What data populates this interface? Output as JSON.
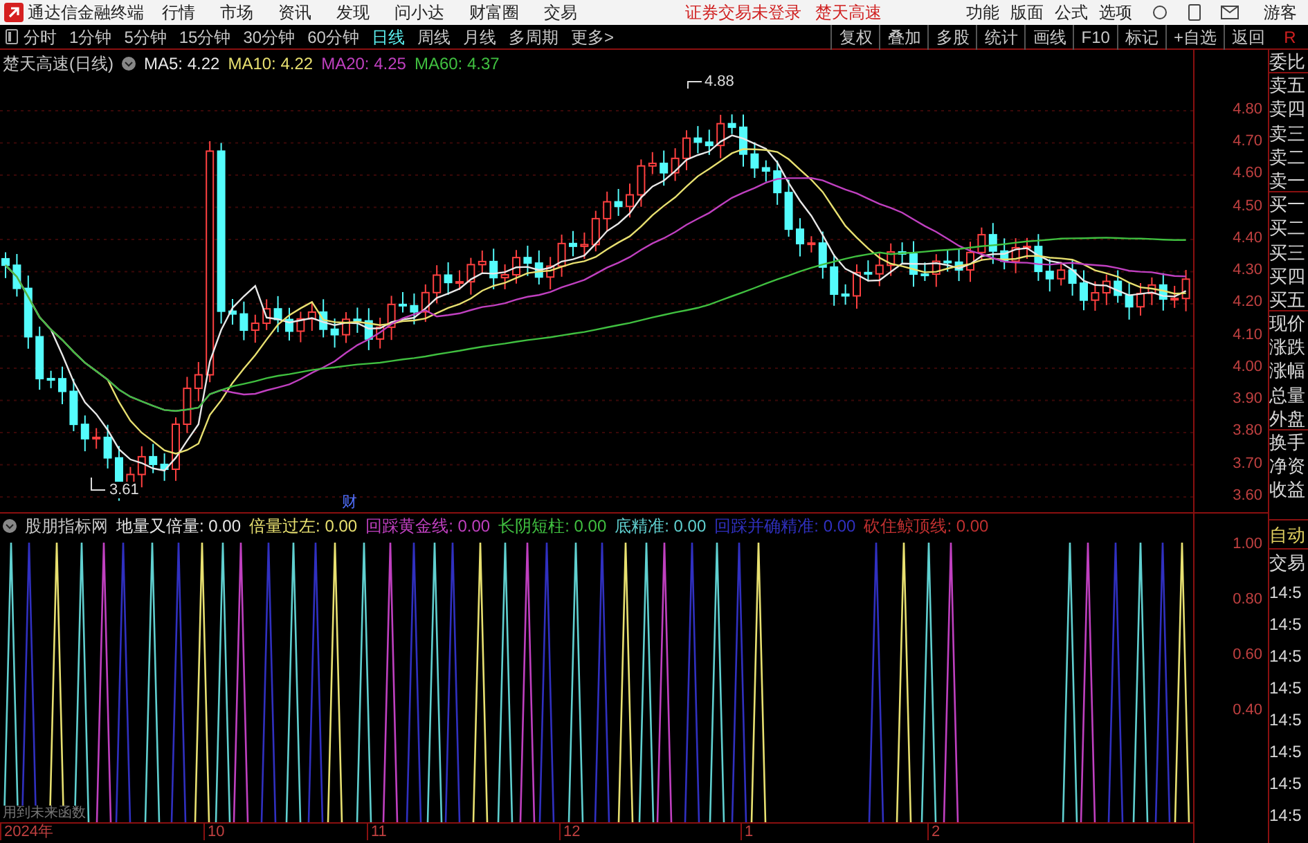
{
  "top_bar": {
    "app_title": "通达信金融终端",
    "menu": [
      "行情",
      "市场",
      "资讯",
      "发现",
      "问小达",
      "财富圈",
      "交易"
    ],
    "notices": [
      "证券交易未登录",
      "楚天高速"
    ],
    "right_menu": [
      "功能",
      "版面",
      "公式",
      "选项"
    ],
    "user": "游客"
  },
  "toolbar": {
    "periods": [
      {
        "label": "分时",
        "selected": false
      },
      {
        "label": "1分钟",
        "selected": false
      },
      {
        "label": "5分钟",
        "selected": false
      },
      {
        "label": "15分钟",
        "selected": false
      },
      {
        "label": "30分钟",
        "selected": false
      },
      {
        "label": "60分钟",
        "selected": false
      },
      {
        "label": "日线",
        "selected": true
      },
      {
        "label": "周线",
        "selected": false
      },
      {
        "label": "月线",
        "selected": false
      },
      {
        "label": "多周期",
        "selected": false
      },
      {
        "label": "更多>",
        "selected": false
      }
    ],
    "buttons": [
      "复权",
      "叠加",
      "多股",
      "统计",
      "画线",
      "F10",
      "标记",
      "+自选",
      "返回"
    ],
    "corner": "R"
  },
  "main_chart": {
    "title": "楚天高速(日线)",
    "ma": [
      {
        "label": "MA5: 4.22",
        "color": "#e8e8e8"
      },
      {
        "label": "MA10: 4.22",
        "color": "#e8e070"
      },
      {
        "label": "MA20: 4.25",
        "color": "#c040c0"
      },
      {
        "label": "MA60: 4.37",
        "color": "#40c040"
      }
    ],
    "high_label": "4.88",
    "low_label": "3.61",
    "event_marker": "财",
    "price_ticks": [
      "4.80",
      "4.70",
      "4.60",
      "4.50",
      "4.40",
      "4.30",
      "4.20",
      "4.10",
      "4.00",
      "3.90",
      "3.80",
      "3.70",
      "3.60"
    ]
  },
  "indicator": {
    "name": "股朋指标网",
    "values": [
      {
        "label": "地量又倍量: 0.00",
        "color": "#e8e8e8"
      },
      {
        "label": "倍量过左: 0.00",
        "color": "#e8e070"
      },
      {
        "label": "回踩黄金线: 0.00",
        "color": "#c040c0"
      },
      {
        "label": "长阴短柱: 0.00",
        "color": "#40c040"
      },
      {
        "label": "底精准: 0.00",
        "color": "#60d0d0"
      },
      {
        "label": "回踩并确精准: 0.00",
        "color": "#3030c0"
      },
      {
        "label": "砍住鲸顶线: 0.00",
        "color": "#c03030"
      }
    ],
    "ticks": [
      "1.00",
      "0.80",
      "0.60",
      "0.40"
    ],
    "note": "用到未来函数"
  },
  "date_axis": [
    "2024年",
    "10",
    "11",
    "12",
    "1",
    "2"
  ],
  "quote_panel": {
    "labels": [
      "委比",
      "卖五",
      "卖四",
      "卖三",
      "卖二",
      "卖一",
      "买一",
      "买二",
      "买三",
      "买四",
      "买五",
      "现价",
      "涨跌",
      "涨幅",
      "总量",
      "外盘",
      "换手",
      "净资",
      "收益"
    ],
    "mode": "自动",
    "trade_label": "交易",
    "times": [
      "14:5",
      "14:5",
      "14:5",
      "14:5",
      "14:5",
      "14:5",
      "14:5",
      "14:5"
    ]
  }
}
